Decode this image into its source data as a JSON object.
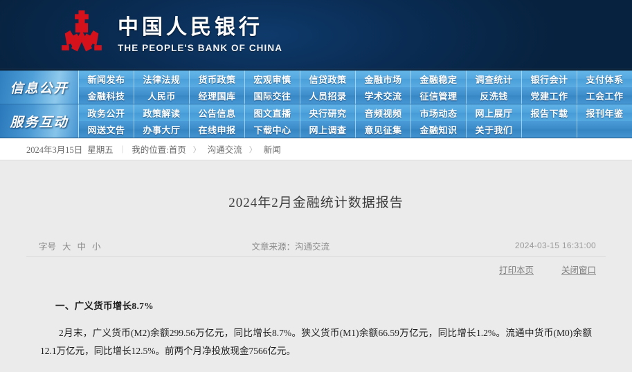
{
  "header": {
    "logo_icon": "pboc-logo-icon",
    "cn_name": "中国人民银行",
    "en_name": "THE PEOPLE'S BANK OF CHINA",
    "bg_color": "#08264a",
    "logo_color": "#d5121b"
  },
  "nav": {
    "blocks": [
      {
        "label": "信息公开",
        "rows": [
          [
            "新闻发布",
            "法律法规",
            "货币政策",
            "宏观审慎",
            "信贷政策",
            "金融市场",
            "金融稳定",
            "调查统计",
            "银行会计",
            "支付体系"
          ],
          [
            "金融科技",
            "人民币",
            "经理国库",
            "国际交往",
            "人员招录",
            "学术交流",
            "征信管理",
            "反洗钱",
            "党建工作",
            "工会工作"
          ]
        ]
      },
      {
        "label": "服务互动",
        "rows": [
          [
            "政务公开",
            "政策解读",
            "公告信息",
            "图文直播",
            "央行研究",
            "音频视频",
            "市场动态",
            "网上展厅",
            "报告下载",
            "报刊年鉴"
          ],
          [
            "网送文告",
            "办事大厅",
            "在线申报",
            "下载中心",
            "网上调查",
            "意见征集",
            "金融知识",
            "关于我们",
            "",
            ""
          ]
        ]
      }
    ],
    "accent_color": "#4b9fd9"
  },
  "breadcrumb": {
    "date": "2024年3月15日",
    "weekday": "星期五",
    "divider": "|",
    "location_label": "我的位置:首页",
    "arrow": "〉",
    "item1": "沟通交流",
    "item2": "新闻"
  },
  "article": {
    "title": "2024年2月金融统计数据报告",
    "font_size_label": "字号",
    "font_size_options": [
      "大",
      "中",
      "小"
    ],
    "source": "文章来源：沟通交流",
    "timestamp": "2024-03-15 16:31:00",
    "print_link": "打印本页",
    "close_link": "关闭窗口",
    "section_heading": "一、广义货币增长8.7%",
    "paragraph": "2月末，广义货币(M2)余额299.56万亿元，同比增长8.7%。狭义货币(M1)余额66.59万亿元，同比增长1.2%。流通中货币(M0)余额12.1万亿元，同比增长12.5%。前两个月净投放现金7566亿元。"
  }
}
